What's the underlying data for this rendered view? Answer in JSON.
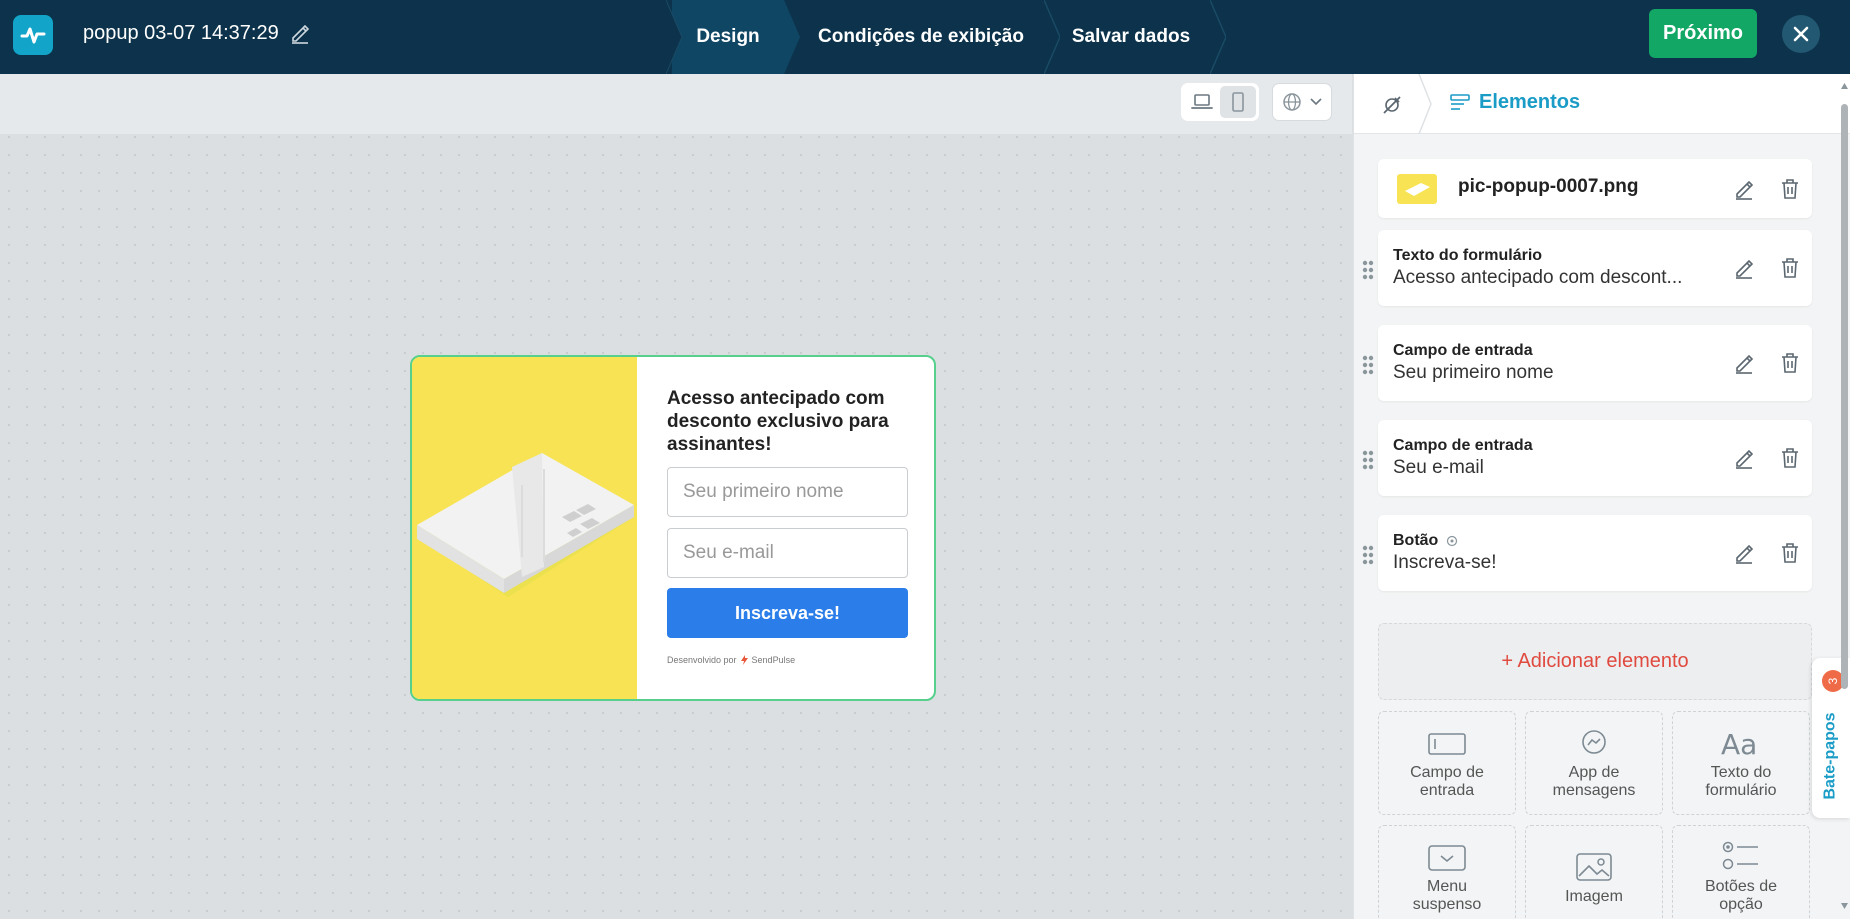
{
  "topbar": {
    "title": "popup 03-07 14:37:29",
    "steps": [
      "Design",
      "Condições de exibição",
      "Salvar dados"
    ],
    "next_label": "Próximo"
  },
  "popup": {
    "heading": "Acesso antecipado com desconto exclusivo para assinantes!",
    "name_placeholder": "Seu primeiro nome",
    "email_placeholder": "Seu e-mail",
    "button_label": "Inscreva-se!",
    "powered_prefix": "Desenvolvido por",
    "powered_brand": "SendPulse"
  },
  "panel": {
    "tab_label": "Elementos",
    "image_element": "pic-popup-0007.png",
    "elements": [
      {
        "title": "Texto do formulário",
        "value": "Acesso antecipado com descont..."
      },
      {
        "title": "Campo de entrada",
        "value": "Seu primeiro nome"
      },
      {
        "title": "Campo de entrada",
        "value": "Seu e-mail"
      },
      {
        "title": "Botão",
        "value": "Inscreva-se!"
      }
    ],
    "add_label": "+ Adicionar elemento",
    "tiles": [
      "Campo de entrada",
      "App de mensagens",
      "Texto do formulário",
      "Menu suspenso",
      "Imagem",
      "Botões de opção"
    ]
  },
  "chat": {
    "label": "Bate-papos",
    "badge": "3"
  },
  "colors": {
    "topbar": "#0c334b",
    "next_button": "#12a764",
    "accent": "#1a9cc7",
    "popup_image": "#f7e353",
    "subscribe_button": "#2b7de9",
    "add_element": "#e04a3f"
  }
}
